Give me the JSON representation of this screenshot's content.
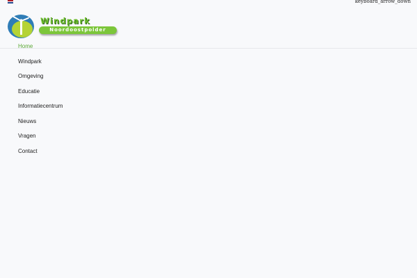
{
  "topbar": {
    "language_flag_colors": [
      "#ae1c28",
      "#ffffff",
      "#21468b"
    ],
    "language_toggle_icon": "keyboard_arrow_down"
  },
  "logo": {
    "title": "Windpark",
    "subtitle": "Noordoostpolder"
  },
  "colors": {
    "accent_green": "#6cbd2b",
    "active_nav": "#5aa834",
    "logo_blue": "#2f7db7",
    "logo_lime": "#b5d335"
  },
  "nav": {
    "items": [
      {
        "label": "Home",
        "active": true
      },
      {
        "label": "Windpark",
        "active": false
      },
      {
        "label": "Omgeving",
        "active": false
      },
      {
        "label": "Educatie",
        "active": false
      },
      {
        "label": "Informatiecentrum",
        "active": false
      },
      {
        "label": "Nieuws",
        "active": false
      },
      {
        "label": "Vragen",
        "active": false
      },
      {
        "label": "Contact",
        "active": false
      }
    ]
  }
}
